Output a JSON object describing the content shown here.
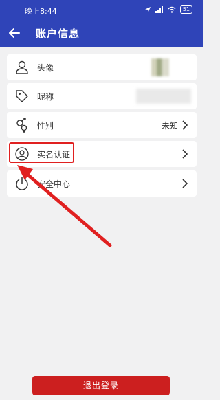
{
  "status_bar": {
    "time": "晚上8:44",
    "battery": "51"
  },
  "header": {
    "title": "账户信息"
  },
  "rows": [
    {
      "label": "头像"
    },
    {
      "label": "昵称"
    },
    {
      "label": "性别",
      "value": "未知"
    },
    {
      "label": "实名认证"
    },
    {
      "label": "安全中心"
    }
  ],
  "logout_button": {
    "label": "退出登录"
  },
  "colors": {
    "header": "#2f44b8",
    "logout": "#cc1f1f",
    "annotation": "#e02020"
  }
}
